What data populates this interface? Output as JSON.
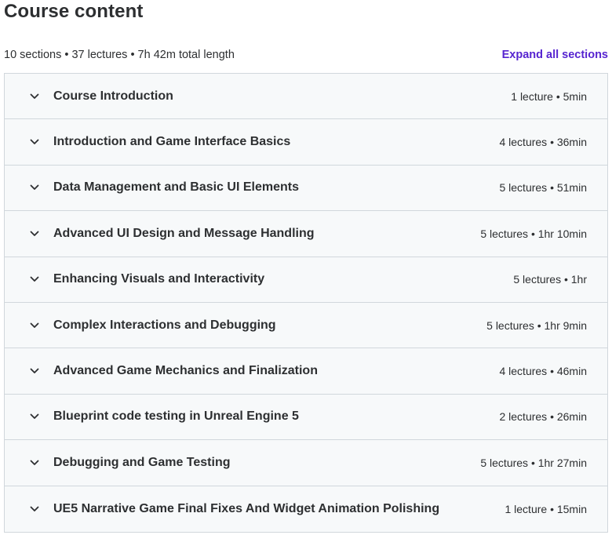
{
  "header": {
    "title": "Course content",
    "summary": "10 sections • 37 lectures • 7h 42m total length",
    "expand_all_label": "Expand all sections"
  },
  "colors": {
    "accent": "#5624d0",
    "text": "#2d2f31",
    "section_bg": "#f7f9fa",
    "border": "#d1d7dc"
  },
  "sections": [
    {
      "title": "Course Introduction",
      "meta": "1 lecture • 5min",
      "icon": "chevron-down-icon"
    },
    {
      "title": "Introduction and Game Interface Basics",
      "meta": "4 lectures • 36min",
      "icon": "chevron-down-icon"
    },
    {
      "title": "Data Management and Basic UI Elements",
      "meta": "5 lectures • 51min",
      "icon": "chevron-down-icon"
    },
    {
      "title": "Advanced UI Design and Message Handling",
      "meta": "5 lectures • 1hr 10min",
      "icon": "chevron-down-icon"
    },
    {
      "title": "Enhancing Visuals and Interactivity",
      "meta": "5 lectures • 1hr",
      "icon": "chevron-down-icon"
    },
    {
      "title": "Complex Interactions and Debugging",
      "meta": "5 lectures • 1hr 9min",
      "icon": "chevron-down-icon"
    },
    {
      "title": "Advanced Game Mechanics and Finalization",
      "meta": "4 lectures • 46min",
      "icon": "chevron-down-icon"
    },
    {
      "title": "Blueprint code testing in Unreal Engine 5",
      "meta": "2 lectures • 26min",
      "icon": "chevron-down-icon"
    },
    {
      "title": "Debugging and Game Testing",
      "meta": "5 lectures • 1hr 27min",
      "icon": "chevron-down-icon"
    },
    {
      "title": "UE5 Narrative Game Final Fixes And Widget Animation Polishing",
      "meta": "1 lecture • 15min",
      "icon": "chevron-down-icon"
    }
  ]
}
